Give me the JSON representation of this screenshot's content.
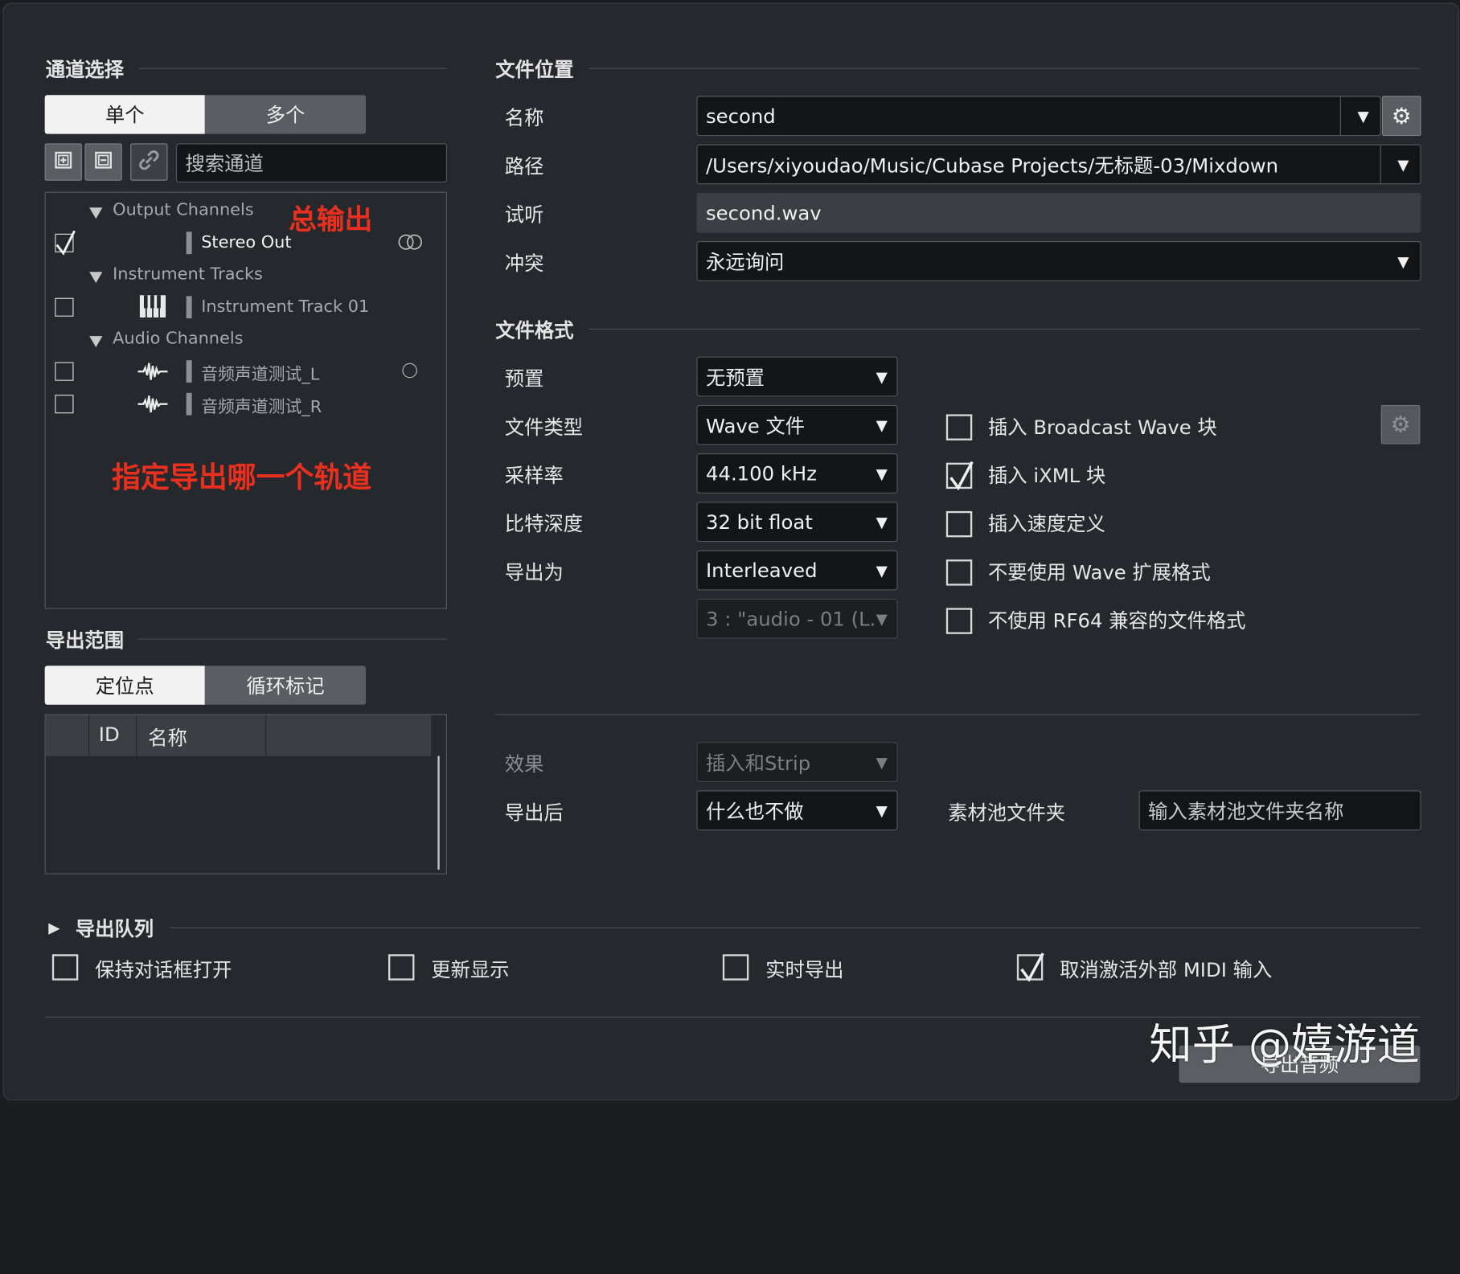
{
  "channel_select": {
    "title": "通道选择",
    "mode_single": "单个",
    "mode_multi": "多个",
    "search_placeholder": "搜索通道",
    "groups": [
      {
        "label": "Output Channels"
      },
      {
        "label": "Instrument Tracks"
      },
      {
        "label": "Audio Channels"
      }
    ],
    "items": [
      {
        "label": "Stereo Out",
        "checked": true
      },
      {
        "label": "Instrument Track 01",
        "checked": false
      },
      {
        "label": "音频声道测试_L",
        "checked": false
      },
      {
        "label": "音频声道测试_R",
        "checked": false
      }
    ],
    "annotation_output": "总输出",
    "annotation_pick": "指定导出哪一个轨道"
  },
  "export_range": {
    "title": "导出范围",
    "mode_locator": "定位点",
    "mode_cycle": "循环标记",
    "col_id": "ID",
    "col_name": "名称"
  },
  "file_location": {
    "title": "文件位置",
    "name_label": "名称",
    "name_value": "second",
    "path_label": "路径",
    "path_value": "/Users/xiyoudao/Music/Cubase Projects/无标题-03/Mixdown",
    "preview_label": "试听",
    "preview_value": "second.wav",
    "conflict_label": "冲突",
    "conflict_value": "永远询问"
  },
  "file_format": {
    "title": "文件格式",
    "preset_label": "预置",
    "preset_value": "无预置",
    "type_label": "文件类型",
    "type_value": "Wave 文件",
    "rate_label": "采样率",
    "rate_value": "44.100 kHz",
    "depth_label": "比特深度",
    "depth_value": "32 bit float",
    "export_as_label": "导出为",
    "export_as_value": "Interleaved",
    "channel_value": "3 : \"audio - 01 (L.",
    "options": [
      {
        "label": "插入 Broadcast Wave 块",
        "checked": false
      },
      {
        "label": "插入 iXML 块",
        "checked": true
      },
      {
        "label": "插入速度定义",
        "checked": false
      },
      {
        "label": "不要使用 Wave 扩展格式",
        "checked": false
      },
      {
        "label": "不使用 RF64 兼容的文件格式",
        "checked": false
      }
    ]
  },
  "post": {
    "effects_label": "效果",
    "effects_value": "插入和Strip",
    "after_label": "导出后",
    "after_value": "什么也不做",
    "pool_label": "素材池文件夹",
    "pool_placeholder": "输入素材池文件夹名称"
  },
  "queue": {
    "title": "导出队列",
    "options": [
      {
        "label": "保持对话框打开",
        "checked": false
      },
      {
        "label": "更新显示",
        "checked": false
      },
      {
        "label": "实时导出",
        "checked": false
      },
      {
        "label": "取消激活外部 MIDI 输入",
        "checked": true
      }
    ],
    "export_button": "导出音频"
  },
  "watermark": "知乎 @嬉游道",
  "icons": [
    "expand-all-icon",
    "collapse-all-icon",
    "link-icon",
    "gear-icon",
    "stereo-link-icon",
    "mono-icon",
    "piano-icon",
    "waveform-icon",
    "dropdown-arrow-icon",
    "checkmark-icon"
  ]
}
